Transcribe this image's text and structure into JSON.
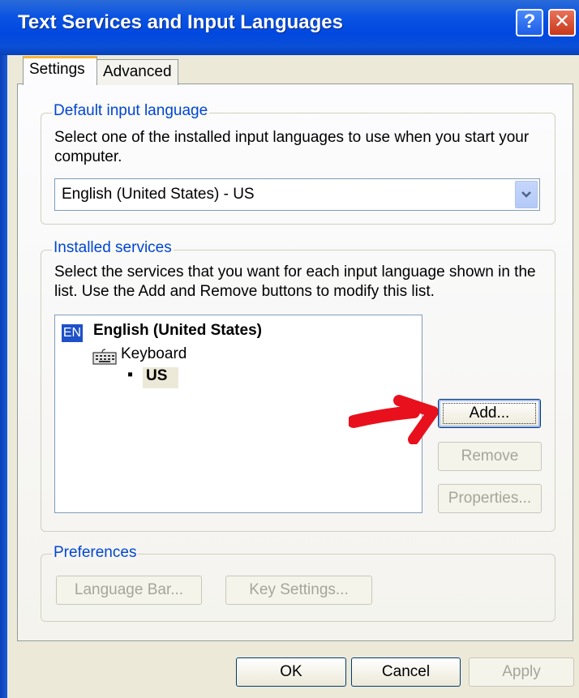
{
  "window": {
    "title": "Text Services and Input Languages",
    "help_label": "?",
    "close_label": "✕"
  },
  "tabs": [
    {
      "label": "Settings",
      "selected": true
    },
    {
      "label": "Advanced",
      "selected": false
    }
  ],
  "default_language": {
    "group_label": "Default input language",
    "description": "Select one of the installed input languages to use when you start your computer.",
    "selected_value": "English (United States) - US"
  },
  "installed_services": {
    "group_label": "Installed services",
    "description": "Select the services that you want for each input language shown in the list. Use the Add and Remove buttons to modify this list.",
    "language_badge": "EN",
    "language": "English (United States)",
    "service_category": "Keyboard",
    "layout": "US",
    "bullet": "▪",
    "buttons": {
      "add": "Add...",
      "remove": "Remove",
      "properties": "Properties..."
    }
  },
  "preferences": {
    "group_label": "Preferences",
    "language_bar": "Language Bar...",
    "key_settings": "Key Settings..."
  },
  "footer": {
    "ok": "OK",
    "cancel": "Cancel",
    "apply": "Apply"
  },
  "colors": {
    "title_bar": "#0a54e3",
    "group_label": "#0046d5",
    "annotation_arrow": "#e8101c"
  },
  "icons": {
    "keyboard": "keyboard-icon",
    "dropdown": "chevron-down-icon"
  }
}
